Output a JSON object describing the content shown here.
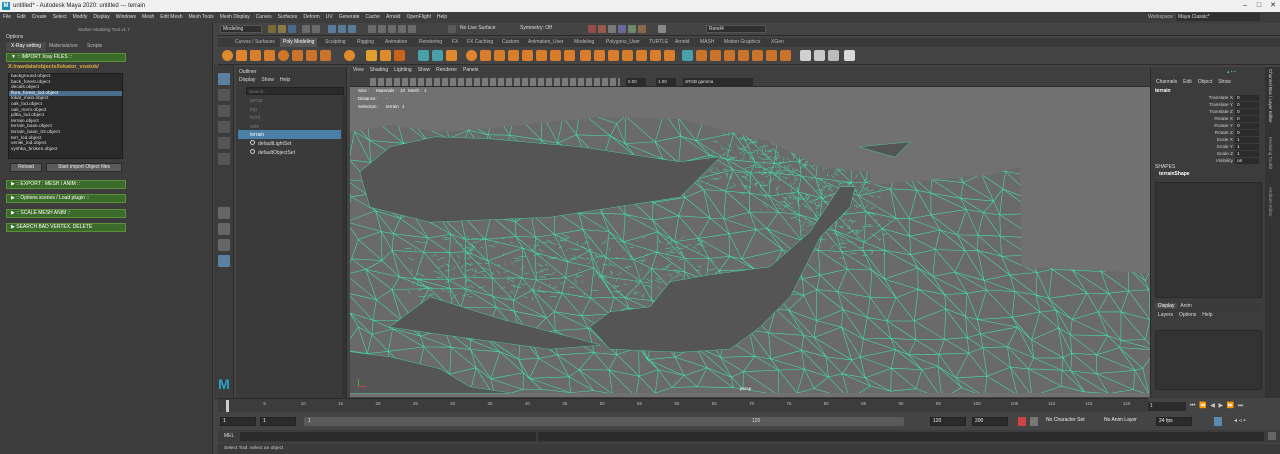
{
  "app": {
    "title": "untitled* - Autodesk Maya 2020: untitled   ---   terrain",
    "logo_letter": "M"
  },
  "menu": [
    "File",
    "Edit",
    "Create",
    "Select",
    "Modify",
    "Display",
    "Windows",
    "Mesh",
    "Edit Mesh",
    "Mesh Tools",
    "Mesh Display",
    "Curves",
    "Surfaces",
    "Deform",
    "UV",
    "Generate",
    "Cache",
    "Arnold",
    "OpenFlight",
    "Help"
  ],
  "status": {
    "mode": "Modeling",
    "live": "No Live Surface",
    "symmetry": "Symmetry: Off",
    "renderer": "Rend4",
    "workspace_label": "Workspace :",
    "workspace": "Maya Classic*"
  },
  "shelf_tabs": [
    "Curves / Surfaces",
    "Poly Modeling",
    "Sculpting",
    "Rigging",
    "Animation",
    "Rendering",
    "FX",
    "FX Caching",
    "Custom",
    "Animation_User",
    "Modeling",
    "Polygons_User",
    "TURTLE",
    "Arnold",
    "MASH",
    "Motion Graphics",
    "XGen"
  ],
  "shelf_active": "Poly Modeling",
  "left_panel": {
    "window_title": "Stalker Modding Tool v1.7",
    "options_label": "Options",
    "tabs": [
      "X-Ray setting",
      "Materials/ure",
      "Scripts"
    ],
    "import_bar": "▼ :: IMPORT Xray FILES ::",
    "path": "X:/rawdata/objects/lokator_vostok/",
    "files": [
      "background.object",
      "back_forest.object",
      "decals.object",
      "flora_forest_lod.object",
      "lokat_main.object",
      "oak_lod.object",
      "oak_mem.object",
      "piltia_lod.object",
      "terrain.object",
      "terrain_base.object",
      "terrain_base_03.object",
      "terr_lod.object",
      "veniki_lod.object",
      "vyshka_broken.object"
    ],
    "selected_file": "flora_forest_lod.object",
    "reload": "Reload",
    "start_import": "Start import Object files",
    "export_bar": "▶ :: EXPORT : MESH / ANIM ::",
    "options_bar": "▶ :: Options scenes / Load plugin ::",
    "scale_bar": "▶ :: SCALE MESH ANIM ::",
    "search_bar": "▶ SEARCH BAD VERTEX. DELETE"
  },
  "outliner": {
    "title": "Outliner",
    "menu": [
      "Display",
      "Show",
      "Help"
    ],
    "search_placeholder": "Search...",
    "items": [
      "persp",
      "top",
      "front",
      "side",
      "terrain",
      "defaultLightSet",
      "defaultObjectSet"
    ],
    "selected": "terrain"
  },
  "viewport": {
    "menu": [
      "View",
      "Shading",
      "Lighting",
      "Show",
      "Renderer",
      "Panels"
    ],
    "near_clip": "0.00",
    "far_clip": "1.00",
    "color_space": "sRGB gamma",
    "hud": {
      "size_label": "Size :",
      "materials_label": "Materials :",
      "materials": "10",
      "mesh_label": "Mesh :",
      "mesh": "1",
      "distance_label": "Distance :",
      "distance": "-",
      "selection_label": "Selection :",
      "selection_obj": "terrain",
      "selection_count": "1"
    },
    "camera": "persp",
    "wire_color": "#3fe3a8",
    "bg_color": "#717171",
    "hole_color": "#555555"
  },
  "channel_box": {
    "menu": [
      "Channels",
      "Edit",
      "Object",
      "Show"
    ],
    "object": "terrain",
    "attrs": [
      {
        "n": "Translate X",
        "v": "0"
      },
      {
        "n": "Translate Y",
        "v": "0"
      },
      {
        "n": "Translate Z",
        "v": "0"
      },
      {
        "n": "Rotate X",
        "v": "0"
      },
      {
        "n": "Rotate Y",
        "v": "0"
      },
      {
        "n": "Rotate Z",
        "v": "0"
      },
      {
        "n": "Scale X",
        "v": "1"
      },
      {
        "n": "Scale Y",
        "v": "1"
      },
      {
        "n": "Scale Z",
        "v": "1"
      },
      {
        "n": "Visibility",
        "v": "on"
      }
    ],
    "shapes_label": "SHAPES",
    "shape": "terrainShape",
    "layer_tabs": [
      "Display",
      "Anim"
    ],
    "layer_menu": [
      "Layers",
      "Options",
      "Help"
    ],
    "side_tabs": [
      "Channel Box / Layer Editor",
      "Modeling Toolkit",
      "Attribute Editor"
    ]
  },
  "timeline": {
    "ticks": [
      "1",
      "5",
      "10",
      "15",
      "20",
      "25",
      "30",
      "35",
      "40",
      "45",
      "50",
      "55",
      "60",
      "65",
      "70",
      "75",
      "80",
      "85",
      "90",
      "95",
      "100",
      "105",
      "110",
      "115",
      "120"
    ],
    "current": "1"
  },
  "range": {
    "start": "1",
    "start2": "1",
    "slider_start": "1",
    "slider_end": "120",
    "end": "120",
    "end2": "200",
    "character": "No Character Set",
    "anim_layer": "No Anim Layer",
    "fps": "24 fps"
  },
  "cmd": {
    "label": "MEL"
  },
  "help": "Select Tool: select an object"
}
